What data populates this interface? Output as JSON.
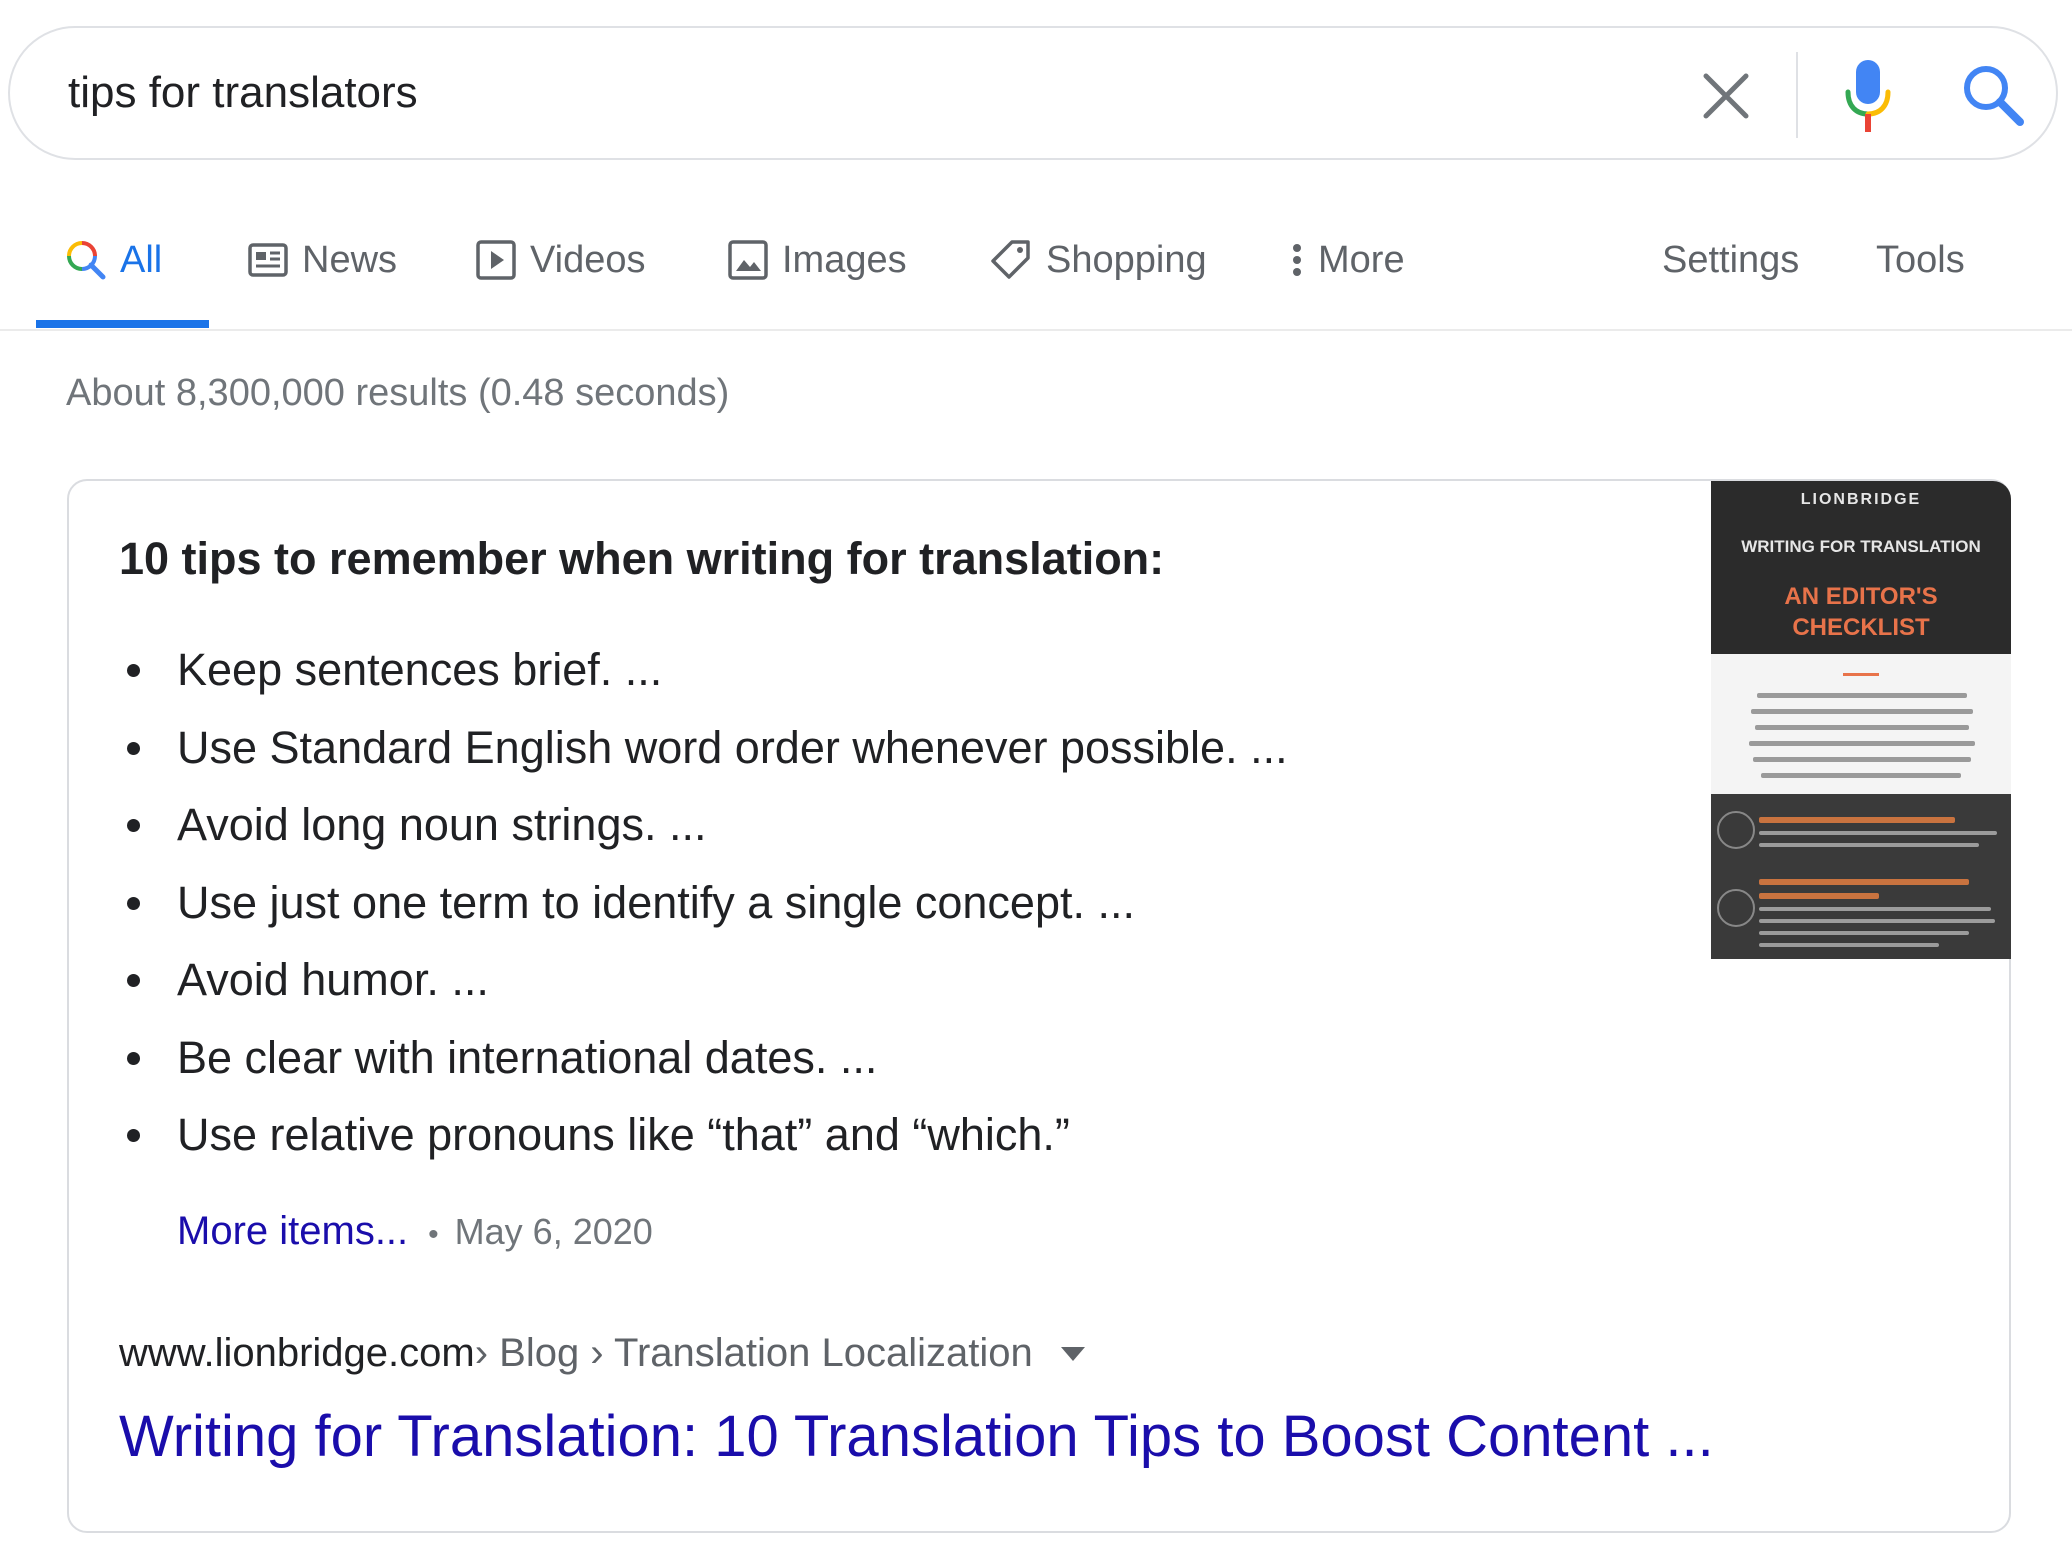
{
  "search": {
    "query": "tips for translators"
  },
  "tabs": [
    {
      "label": "All",
      "icon": "search-icon"
    },
    {
      "label": "News",
      "icon": "news-icon"
    },
    {
      "label": "Videos",
      "icon": "video-icon"
    },
    {
      "label": "Images",
      "icon": "image-icon"
    },
    {
      "label": "Shopping",
      "icon": "tag-icon"
    },
    {
      "label": "More",
      "icon": "more-vert-icon"
    }
  ],
  "tools": {
    "settings": "Settings",
    "tools": "Tools"
  },
  "result_stats": "About 8,300,000 results (0.48 seconds)",
  "snippet": {
    "title": "10 tips to remember when writing for translation:",
    "items": [
      "Keep sentences brief. ...",
      "Use Standard English word order whenever possible. ...",
      "Avoid long noun strings. ...",
      "Use just one term to identify a single concept. ...",
      "Avoid humor. ...",
      "Be clear with international dates. ...",
      "Use relative pronouns like “that” and “which.”"
    ],
    "more_items": "More items...",
    "separator": "•",
    "date": "May 6, 2020",
    "breadcrumb_domain": "www.lionbridge.com",
    "breadcrumb_path": " › Blog › Translation Localization",
    "result_title": "Writing for Translation: 10 Translation Tips to Boost Content ...",
    "thumbnail": {
      "brand": "LIONBRIDGE",
      "subtitle": "WRITING FOR TRANSLATION",
      "headline_1": "AN EDITOR'S",
      "headline_2": "CHECKLIST"
    }
  },
  "colors": {
    "link_blue": "#1a0dab",
    "active_tab_blue": "#1a73e8",
    "muted_gray": "#70757a"
  }
}
